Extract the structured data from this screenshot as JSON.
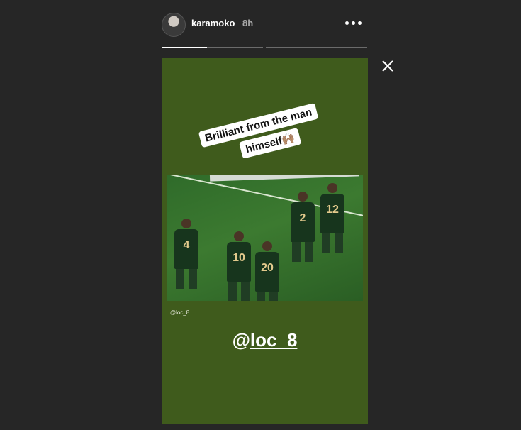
{
  "header": {
    "avatar_icon": "user-avatar-icon",
    "username": "karamoko",
    "time": "8h",
    "more_icon": "more-options-icon"
  },
  "progress": {
    "segments": [
      {
        "state": "active",
        "fill": 0.45
      },
      {
        "state": "pending",
        "fill": 0
      }
    ]
  },
  "close_icon": "close-icon",
  "story": {
    "background": "#3f5b1c",
    "caption_line1": "Brilliant from the man",
    "caption_line2": "himself🙌🏽",
    "photo": {
      "player_numbers": [
        "4",
        "10",
        "20",
        "2",
        "12"
      ]
    },
    "photo_credit": "@loc_8",
    "mention_at": "@",
    "mention_handle": "loc_8"
  }
}
